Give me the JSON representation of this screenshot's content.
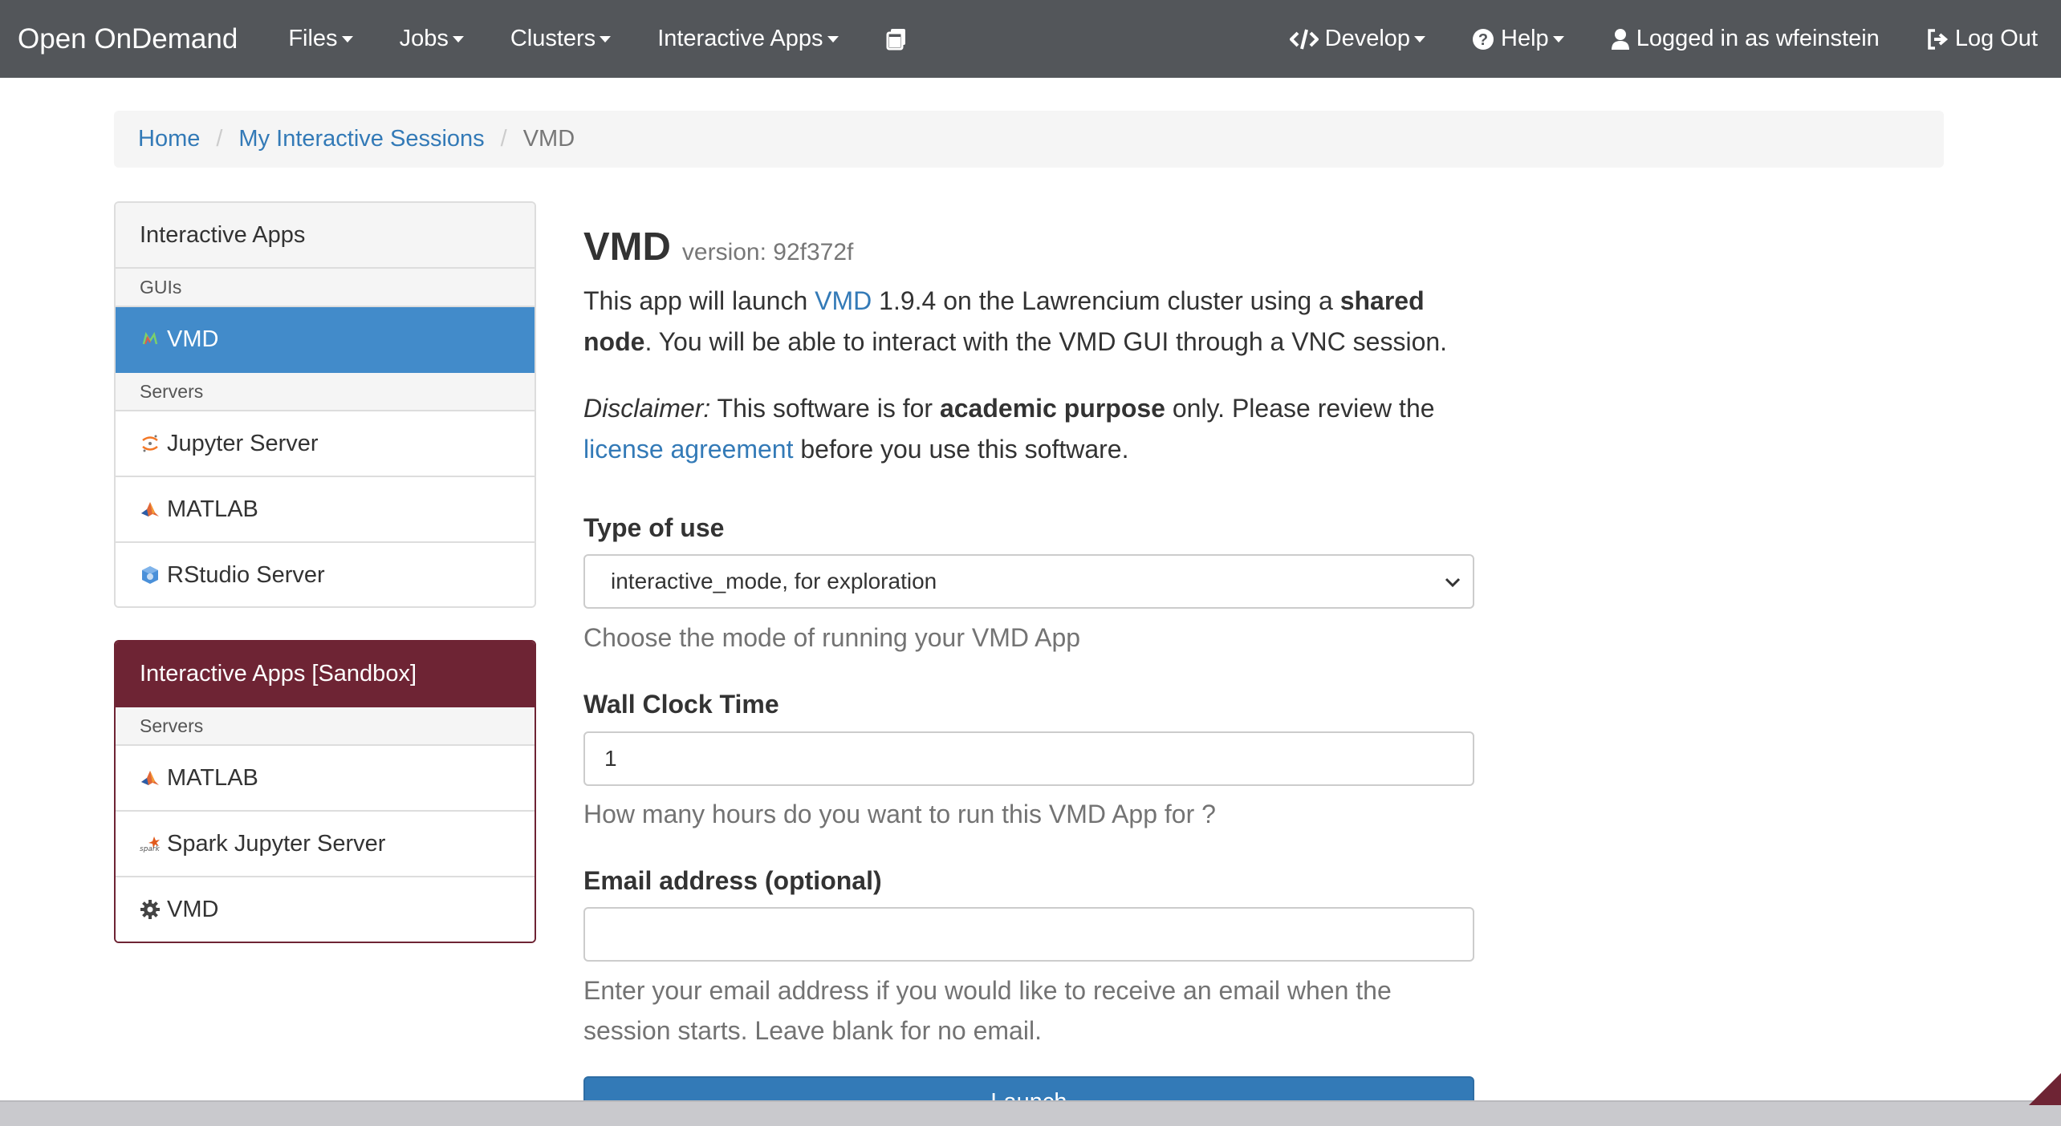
{
  "navbar": {
    "brand": "Open OnDemand",
    "menus": [
      "Files",
      "Jobs",
      "Clusters",
      "Interactive Apps"
    ],
    "develop": "Develop",
    "help": "Help",
    "logged_in": "Logged in as wfeinstein",
    "logout": "Log Out"
  },
  "breadcrumb": {
    "home": "Home",
    "sessions": "My Interactive Sessions",
    "current": "VMD"
  },
  "sidebar": {
    "heading": "Interactive Apps",
    "groups": [
      {
        "label": "GUIs",
        "items": [
          {
            "label": "VMD",
            "icon": "vmd-icon",
            "active": true
          }
        ]
      },
      {
        "label": "Servers",
        "items": [
          {
            "label": "Jupyter Server",
            "icon": "jupyter-icon"
          },
          {
            "label": "MATLAB",
            "icon": "matlab-icon"
          },
          {
            "label": "RStudio Server",
            "icon": "rstudio-icon"
          }
        ]
      }
    ]
  },
  "sandbox": {
    "heading": "Interactive Apps [Sandbox]",
    "group": "Servers",
    "items": [
      {
        "label": "MATLAB",
        "icon": "matlab-icon"
      },
      {
        "label": "Spark Jupyter Server",
        "icon": "spark-icon"
      },
      {
        "label": "VMD",
        "icon": "gear-icon"
      }
    ]
  },
  "main": {
    "title": "VMD",
    "version": "version: 92f372f",
    "intro": {
      "t1": "This app will launch ",
      "link": "VMD",
      "t2": " 1.9.4 on the Lawrencium cluster using a ",
      "bold": "shared node",
      "t3": ". You will be able to interact with the VMD GUI through a VNC session."
    },
    "disclaimer": {
      "label": "Disclaimer:",
      "t1": " This software is for ",
      "bold": "academic purpose",
      "t2": " only. Please review the ",
      "link": "license agreement",
      "t3": " before you use this software."
    },
    "type_of_use": {
      "label": "Type of use",
      "value": "interactive_mode, for exploration",
      "help": "Choose the mode of running your VMD App"
    },
    "wall_clock": {
      "label": "Wall Clock Time",
      "value": "1",
      "help": "How many hours do you want to run this VMD App for ?"
    },
    "email": {
      "label": "Email address (optional)",
      "value": "",
      "help": "Enter your email address if you would like to receive an email when the session starts. Leave blank for no email."
    },
    "launch": "Launch"
  },
  "colors": {
    "navbar": "#53565a",
    "link": "#337ab7",
    "active": "#428bca",
    "sandbox": "#6e2434"
  }
}
